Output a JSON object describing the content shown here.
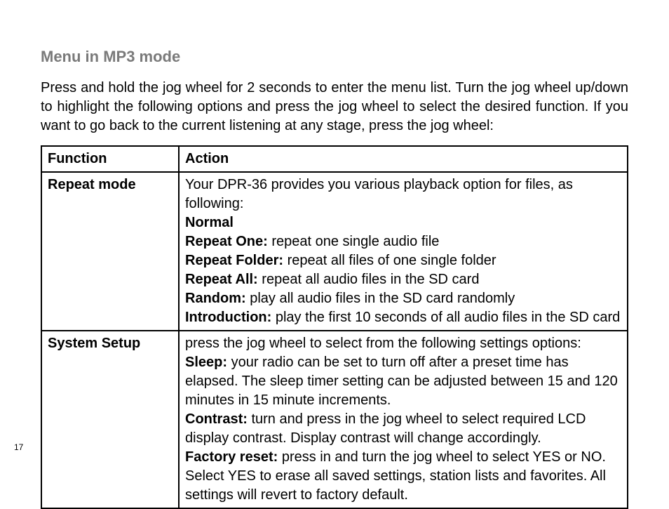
{
  "heading": "Menu in MP3 mode",
  "intro": "Press and hold the jog wheel for 2 seconds to enter the menu list. Turn the jog wheel up/down to highlight the following options and press the jog wheel to select the desired function. If you want to go back to the current listening at any stage, press the jog wheel:",
  "table": {
    "headers": {
      "function": "Function",
      "action": "Action"
    },
    "rows": [
      {
        "function": "Repeat mode",
        "intro": "Your DPR-36 provides you various playback option for files, as following:",
        "items": [
          {
            "label": "Normal",
            "desc": ""
          },
          {
            "label": "Repeat One:",
            "desc": " repeat one single audio file"
          },
          {
            "label": "Repeat Folder:",
            "desc": " repeat all files of one single folder"
          },
          {
            "label": "Repeat All:",
            "desc": " repeat all audio files in the SD card"
          },
          {
            "label": "Random:",
            "desc": " play all audio files in the SD card randomly"
          },
          {
            "label": "Introduction:",
            "desc": " play the first 10 seconds of all audio files in the SD card"
          }
        ]
      },
      {
        "function": "System Setup",
        "intro": "press the jog wheel to select from the following settings options:",
        "items": [
          {
            "label": "Sleep:",
            "desc": " your radio can be set to turn off after a preset time has elapsed. The sleep timer setting can be adjusted between 15 and 120 minutes in 15 minute increments."
          },
          {
            "label": "Contrast:",
            "desc": " turn and press in the jog wheel to select required LCD display contrast. Display contrast will change accordingly."
          },
          {
            "label": "Factory reset:",
            "desc": " press in and turn the jog wheel to select YES or NO. Select YES to erase all saved settings, station lists and favorites. All settings will revert to factory default."
          }
        ]
      }
    ]
  },
  "page_number": "17"
}
